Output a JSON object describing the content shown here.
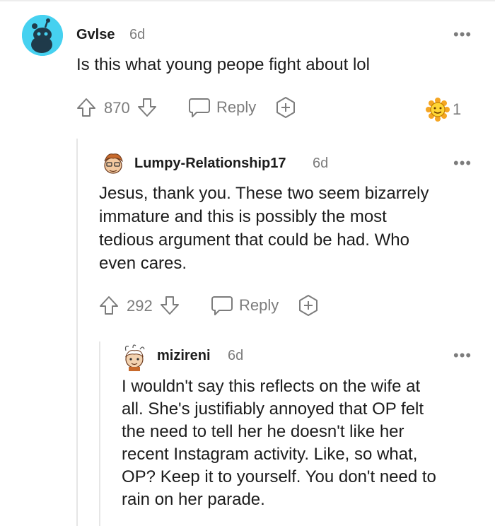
{
  "comments": [
    {
      "username": "Gvlse",
      "age": "6d",
      "text": "Is this what young peope fight about lol",
      "votes": "870",
      "reply_label": "Reply",
      "award_count": "1"
    },
    {
      "username": "Lumpy-Relationship17",
      "age": "6d",
      "text_lines": [
        "Jesus, thank you. These two seem bizarrely",
        "immature and this is possibly the most",
        "tedious argument that could be had. Who",
        "even cares."
      ],
      "votes": "292",
      "reply_label": "Reply"
    },
    {
      "username": "mizireni",
      "age": "6d",
      "text_lines": [
        "I wouldn't say this reflects on the wife at",
        "all. She's justifiably annoyed that OP felt",
        "the need to tell her he doesn't like her",
        "recent Instagram activity. Like, so what,",
        "OP? Keep it to yourself. You don't need to",
        "rain on her parade."
      ]
    }
  ],
  "more_label": "•••",
  "icons": {
    "upvote": "arrow-up-icon",
    "downvote": "arrow-down-icon",
    "reply": "speech-bubble-icon",
    "award": "plus-circle-icon",
    "award_badge": "sunflower-award-icon"
  },
  "colors": {
    "avatar_bg": "#46d1f0",
    "muted": "#7c7c7c",
    "text": "#1c1c1c"
  }
}
